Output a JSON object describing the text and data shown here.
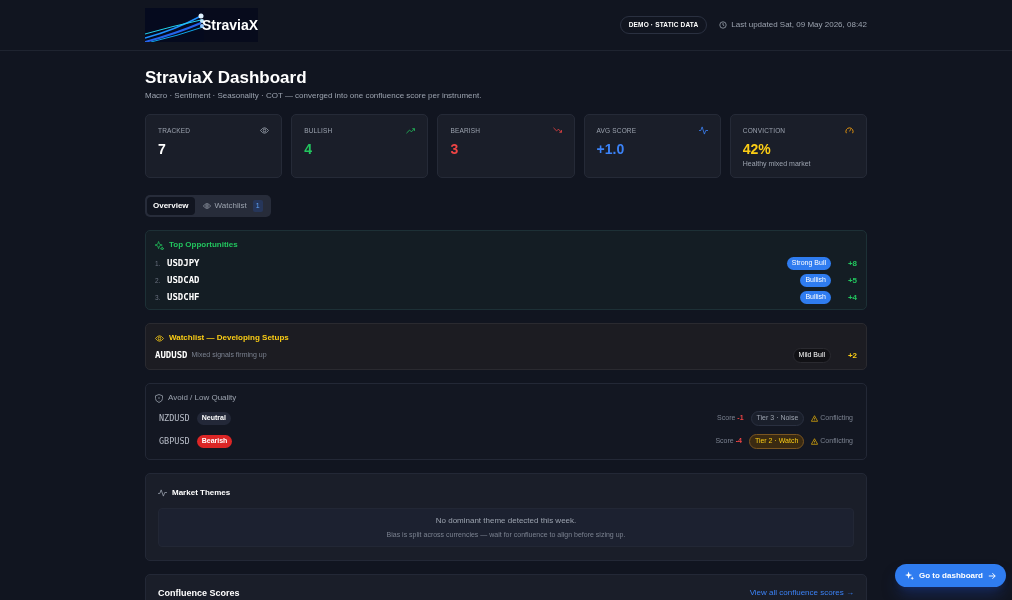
{
  "header": {
    "logo_text": "StraviaX",
    "badge": "DEMO · STATIC DATA",
    "last_updated": "Last updated Sat, 09 May 2026, 08:42"
  },
  "title": "StraviaX Dashboard",
  "subtitle": "Macro · Sentiment · Seasonality · COT — converged into one confluence score per instrument.",
  "stats": [
    {
      "label": "TRACKED",
      "value": "7",
      "color": "#ffffff",
      "kind": "eye"
    },
    {
      "label": "BULLISH",
      "value": "4",
      "color": "#22c55e",
      "kind": "trend-up"
    },
    {
      "label": "BEARISH",
      "value": "3",
      "color": "#ef4444",
      "kind": "trend-down"
    },
    {
      "label": "AVG SCORE",
      "value": "+1.0",
      "color": "#3b82f6",
      "kind": "activity"
    },
    {
      "label": "CONVICTION",
      "value": "42%",
      "color": "#facc15",
      "kind": "gauge",
      "note": "Healthy mixed market"
    }
  ],
  "tabs": [
    {
      "label": "Overview",
      "selected": true
    },
    {
      "label": "Watchlist",
      "selected": false,
      "count": "1"
    }
  ],
  "top_opportunities": {
    "title": "Top Opportunities",
    "items": [
      {
        "rank": "1.",
        "symbol": "USDJPY",
        "badge": "Strong Bull",
        "score": "+8"
      },
      {
        "rank": "2.",
        "symbol": "USDCAD",
        "badge": "Bullish",
        "score": "+5"
      },
      {
        "rank": "3.",
        "symbol": "USDCHF",
        "badge": "Bullish",
        "score": "+4"
      }
    ]
  },
  "watchlist": {
    "title": "Watchlist — Developing Setups",
    "items": [
      {
        "symbol": "AUDUSD",
        "note": "Mixed signals firming up",
        "badge": "Mild Bull",
        "score": "+2"
      }
    ]
  },
  "avoid": {
    "title": "Avoid / Low Quality",
    "items": [
      {
        "symbol": "NZDUSD",
        "bias": {
          "text": "Neutral",
          "kind": "neutral"
        },
        "score_label": "Score",
        "score": "-1",
        "tier": {
          "text": "Tier 3 · Noise",
          "kind": "noise"
        },
        "flag": "Conflicting"
      },
      {
        "symbol": "GBPUSD",
        "bias": {
          "text": "Bearish",
          "kind": "bearish"
        },
        "score_label": "Score",
        "score": "-4",
        "tier": {
          "text": "Tier 2 · Watch",
          "kind": "watch"
        },
        "flag": "Conflicting"
      }
    ]
  },
  "themes": {
    "title": "Market Themes",
    "empty_title": "No dominant theme detected this week.",
    "empty_text": "Bias is split across currencies — wait for confluence to align before sizing up."
  },
  "confluence": {
    "title": "Confluence Scores",
    "link": "View all confluence scores →"
  },
  "fab": {
    "label": "Go to dashboard"
  }
}
